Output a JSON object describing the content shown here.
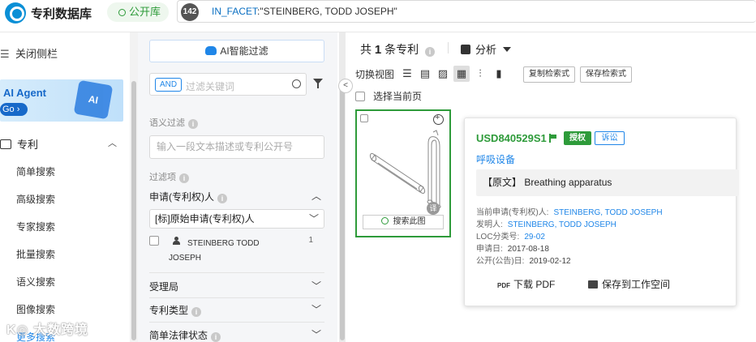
{
  "app": {
    "title": "专利数据库",
    "db_tag": "公开库"
  },
  "query": {
    "count": "142",
    "field": "IN_FACET",
    "value": ":\"STEINBERG, TODD JOSEPH\""
  },
  "sidebar": {
    "close_label": "关闭侧栏",
    "ai_agent": {
      "title": "AI Agent",
      "go": "Go",
      "cube_label": "AI"
    },
    "patent_label": "专利",
    "items": [
      "简单搜索",
      "高级搜索",
      "专家搜索",
      "批量搜索",
      "语义搜索",
      "图像搜索",
      "更多搜索"
    ],
    "watermark": "大数跨境"
  },
  "filter": {
    "ai_filter": "AI智能过滤",
    "and_tag": "AND",
    "keyword_placeholder": "过滤关键词",
    "semantic_label": "语义过滤",
    "semantic_placeholder": "输入一段文本描述或专利公开号",
    "items_label": "过滤项",
    "applicant_group": "申请(专利权)人",
    "applicant_select": "[标]原始申请(专利权)人",
    "applicant_name_1": "STEINBERG TODD",
    "applicant_name_2": "JOSEPH",
    "applicant_count": "1",
    "groups": [
      "受理局",
      "专利类型",
      "简单法律状态"
    ]
  },
  "main": {
    "result_prefix": "共",
    "result_count": "1",
    "result_suffix": "条专利",
    "analysis": "分析",
    "view_label": "切换视图",
    "copy_query": "复制检索式",
    "save_query": "保存检索式",
    "select_page": "选择当前页",
    "search_figure": "搜索此图",
    "translate": "译"
  },
  "popup": {
    "pn": "USD840529S1",
    "grant_badge": "授权",
    "litigation_badge": "诉讼",
    "title": "呼吸设备",
    "original": "【原文】 Breathing apparatus",
    "applicant_label": "当前申请(专利权)人:",
    "applicant": "STEINBERG, TODD JOSEPH",
    "inventor_label": "发明人:",
    "inventor": "STEINBERG, TODD JOSEPH",
    "loc_label": "LOC分类号:",
    "loc": "29-02",
    "app_date_label": "申请日:",
    "app_date": "2017-08-18",
    "pub_date_label": "公开(公告)日:",
    "pub_date": "2019-02-12",
    "pdf_icon_text": "PDF",
    "download_pdf": "下载 PDF",
    "save_workspace": "保存到工作空间"
  },
  "colors": {
    "brand_green": "#2e9b3a",
    "link_blue": "#1f86e8",
    "logo_blue": "#0a8fd6"
  }
}
